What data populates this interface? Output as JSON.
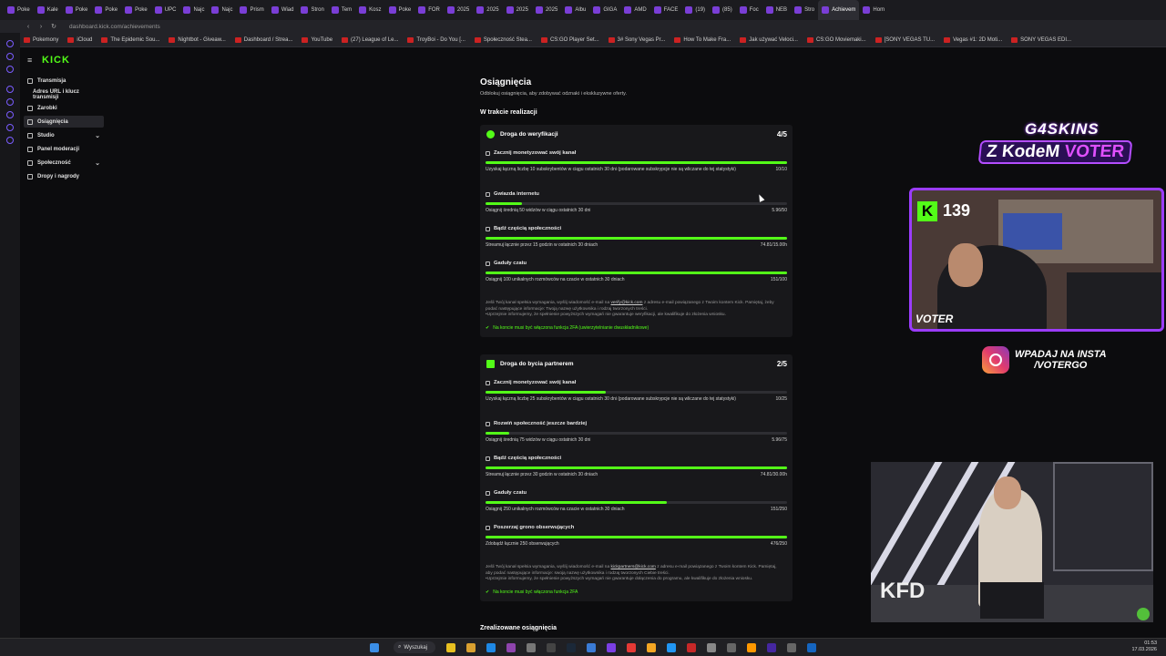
{
  "browser": {
    "tabs": [
      "Poke",
      "Kale",
      "Poke",
      "Poke",
      "Poke",
      "UPC",
      "Najc",
      "Najc",
      "Prism",
      "Wiad",
      "Stron",
      "Tem",
      "Kosz",
      "Poke",
      "FOR",
      "2025",
      "2025",
      "2025",
      "2025",
      "Albu",
      "GIGA",
      "AMD",
      "FACE",
      "(19)",
      "(85)",
      "Foc",
      "NEB",
      "Stro",
      "Achievem",
      "Hom"
    ],
    "active_tab": "Achievem",
    "url": "dashboard.kick.com/achievements"
  },
  "bookmarks": [
    "Pokemony",
    "iCloud",
    "The Epidemic Sou...",
    "Nightbot - Giveaw...",
    "Dashboard / Strea...",
    "YouTube",
    "(27) League of Le...",
    "TroyBoi - Do You [...",
    "Społeczność Stea...",
    "CS:GO Player Set...",
    "3# Sony Vegas Pr...",
    "How To Make Fra...",
    "Jak używać Veloci...",
    "CS:GO Moviemaki...",
    "[SONY VEGAS TU...",
    "Vegas #1: 2D Moti...",
    "SONY VEGAS EDI..."
  ],
  "sidebar": {
    "logo": "KICK",
    "items": [
      {
        "label": "Transmisja",
        "chev": false
      },
      {
        "label": "Adres URL i klucz transmisji",
        "chev": false
      },
      {
        "label": "Zarobki",
        "chev": false
      },
      {
        "label": "Osiągnięcia",
        "chev": false
      },
      {
        "label": "Studio",
        "chev": true
      },
      {
        "label": "Panel moderacji",
        "chev": false
      },
      {
        "label": "Społeczność",
        "chev": true
      },
      {
        "label": "Dropy i nagrody",
        "chev": false
      }
    ]
  },
  "page": {
    "title": "Osiągnięcia",
    "subtitle": "Odblokuj osiągnięcia, aby zdobywać odznaki i ekskluzywne oferty.",
    "section": "W trakcie realizacji",
    "done_section": "Zrealizowane osiągnięcia"
  },
  "cards": [
    {
      "title": "Droga do weryfikacji",
      "count": "4/5",
      "reqs": [
        {
          "title": "Zacznij monetyzować swój kanał",
          "desc": "Uzyskaj łączną liczbę 10 subskrybentów w ciągu ostatnich 30 dni (podarowane subskrypcje nie są wliczane do tej statystyki)",
          "value": "10/10",
          "progress": 1.0
        },
        {
          "title": "Gwiazda internetu",
          "desc": "Osiągnij średnią 50 widzów w ciągu ostatnich 30 dni",
          "value": "5.96/50",
          "progress": 0.12
        },
        {
          "title": "Bądź częścią społeczności",
          "desc": "Streamuj łącznie przez 15 godzin w ostatnich 30 dniach",
          "value": "74.81/15.00h",
          "progress": 1.0
        },
        {
          "title": "Gaduły czatu",
          "desc": "Osiągnij 100 unikalnych rozmówców na czacie w ostatnich 30 dniach",
          "value": "151/100",
          "progress": 1.0
        }
      ],
      "note_pre": "Jeśli Twój kanał spełnia wymagania, wyślij wiadomość e-mail na ",
      "note_link": "verify@kick.com",
      "note_post": " z adresu e-mail powiązanego z Twoim kontem Kick. Pamiętaj, żeby podać następujące informacje: Twoją nazwę użytkownika i rodzaj tworzonych treści.",
      "note2": "•Uprzejmie informujemy, że spełnienie powyższych wymagań nie gwarantuje weryfikacji, ale kwalifikuje do złożenia wniosku.",
      "check": "Na koncie musi być włączona funkcja 2FA (uwierzytelnianie dwuskładnikowe)"
    },
    {
      "title": "Droga do bycia partnerem",
      "count": "2/5",
      "reqs": [
        {
          "title": "Zacznij monetyzować swój kanał",
          "desc": "Uzyskaj łączną liczbę 25 subskrybentów w ciągu ostatnich 30 dni (podarowane subskrypcje nie są wliczane do tej statystyki)",
          "value": "10/25",
          "progress": 0.4
        },
        {
          "title": "Rozwiń społeczność jeszcze bardziej",
          "desc": "Osiągnij średnią 75 widzów w ciągu ostatnich 30 dni",
          "value": "5.96/75",
          "progress": 0.08
        },
        {
          "title": "Bądź częścią społeczności",
          "desc": "Streamuj łącznie przez 30 godzin w ostatnich 30 dniach",
          "value": "74.81/30.00h",
          "progress": 1.0
        },
        {
          "title": "Gaduły czatu",
          "desc": "Osiągnij 250 unikalnych rozmówców na czacie w ostatnich 30 dniach",
          "value": "151/250",
          "progress": 0.6
        },
        {
          "title": "Poszerzaj grono obserwujących",
          "desc": "Zdobądź łącznie 250 obserwujących",
          "value": "476/250",
          "progress": 1.0
        }
      ],
      "note_pre": "Jeśli Twój kanał spełnia wymagania, wyślij wiadomość e-mail na ",
      "note_link": "kickpartners@kick.com",
      "note_post": " z adresu e-mail powiązanego z Twoim kontem Kick. Pamiętaj, aby podać następujące informacje: swoją nazwę użytkownika i rodzaj tworzonych Ciebie treści.",
      "note2": "•Uprzejmie informujemy, że spełnienie powyższych wymagań nie gwarantuje dołączenia do programu, ale kwalifikuje do złożenia wniosku.",
      "check": "Na koncie musi być włączona funkcja 2FA"
    }
  ],
  "overlay": {
    "brand": "G4SKINS",
    "code_pre": "Z KodeM ",
    "code_name": "VOTER",
    "viewers": "139",
    "cam_name": "VOTER",
    "insta_line1": "WPADAJ NA INSTA",
    "insta_line2": "/VOTERGO",
    "studio_text": "KFD"
  },
  "taskbar": {
    "search": "Wyszukaj",
    "time": "01:53",
    "date": "17.03.2026"
  },
  "colors": {
    "accent": "#53fc18",
    "overlay": "#9b3cff"
  }
}
